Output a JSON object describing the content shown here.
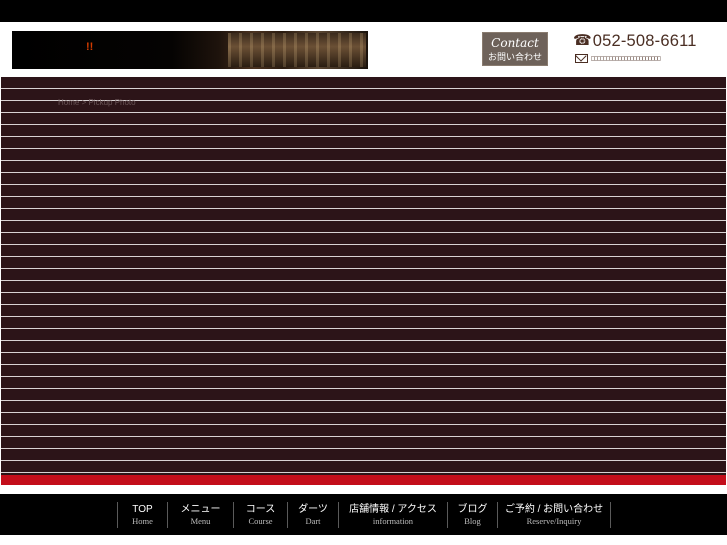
{
  "header": {
    "banner_text": "!!",
    "contact_script": "Contact",
    "contact_label": "お問い合わせ",
    "phone": "052-508-6611",
    "email": "□□□□□□□□□□□□□□□□□□□□□□□"
  },
  "main": {
    "breadcrumb": "Home > Pickup Photo"
  },
  "nav": [
    {
      "label": "TOP",
      "sub": "Home"
    },
    {
      "label": "メニュー",
      "sub": "Menu"
    },
    {
      "label": "コース",
      "sub": "Course"
    },
    {
      "label": "ダーツ",
      "sub": "Dart"
    },
    {
      "label": "店舗情報 / アクセス",
      "sub": "information"
    },
    {
      "label": "ブログ",
      "sub": "Blog"
    },
    {
      "label": "ご予約 / お問い合わせ",
      "sub": "Reserve/Inquiry"
    }
  ],
  "colors": {
    "main_bg": "#2c1418",
    "accent_red": "#c30d1a",
    "brand_brown": "#4a2e23"
  },
  "icons": {
    "phone": "telephone-icon",
    "mail": "envelope-icon"
  }
}
